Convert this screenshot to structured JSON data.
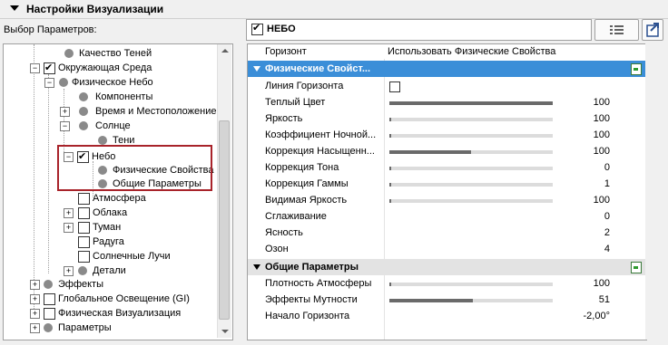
{
  "header": {
    "title": "Настройки Визуализации"
  },
  "param_select_label": "Выбор Параметров:",
  "tree": {
    "items": [
      {
        "label": "Качество Теней"
      },
      {
        "label": "Окружающая Среда"
      },
      {
        "label": "Физическое Небо"
      },
      {
        "label": "Компоненты"
      },
      {
        "label": "Время и Местоположение"
      },
      {
        "label": "Солнце"
      },
      {
        "label": "Тени"
      },
      {
        "label": "Небо"
      },
      {
        "label": "Физические Свойства"
      },
      {
        "label": "Общие Параметры"
      },
      {
        "label": "Атмосфера"
      },
      {
        "label": "Облака"
      },
      {
        "label": "Туман"
      },
      {
        "label": "Радуга"
      },
      {
        "label": "Солнечные Лучи"
      },
      {
        "label": "Детали"
      },
      {
        "label": "Эффекты"
      },
      {
        "label": "Глобальное Освещение (GI)"
      },
      {
        "label": "Физическая Визуализация"
      },
      {
        "label": "Параметры"
      }
    ]
  },
  "panel": {
    "selected_name": "НЕБО",
    "rows": [
      {
        "name": "Горизонт",
        "value": "Использовать Физические Свойства"
      }
    ],
    "section1": {
      "title": "Физические Свойст...",
      "props": [
        {
          "name": "Линия Горизонта"
        },
        {
          "name": "Теплый Цвет",
          "value": "100",
          "level": 1.0
        },
        {
          "name": "Яркость",
          "value": "100",
          "level": 0.01
        },
        {
          "name": "Коэффициент Ночной...",
          "value": "100",
          "level": 0.01
        },
        {
          "name": "Коррекция Насыщенн...",
          "value": "100",
          "level": 0.5
        },
        {
          "name": "Коррекция Тона",
          "value": "0",
          "level": 0.01
        },
        {
          "name": "Коррекция Гаммы",
          "value": "1",
          "level": 0.01
        },
        {
          "name": "Видимая Яркость",
          "value": "100",
          "level": 0.01
        },
        {
          "name": "Сглаживание",
          "value": "0"
        },
        {
          "name": "Ясность",
          "value": "2"
        },
        {
          "name": "Озон",
          "value": "4"
        }
      ]
    },
    "section2": {
      "title": "Общие Параметры",
      "props": [
        {
          "name": "Плотность Атмосферы",
          "value": "100",
          "level": 0.01
        },
        {
          "name": "Эффекты Мутности",
          "value": "51",
          "level": 0.51
        },
        {
          "name": "Начало Горизонта",
          "value": "-2,00°"
        }
      ]
    }
  },
  "colors": {
    "section_active": "#3b8ed8",
    "highlight_box": "#a8232a"
  }
}
